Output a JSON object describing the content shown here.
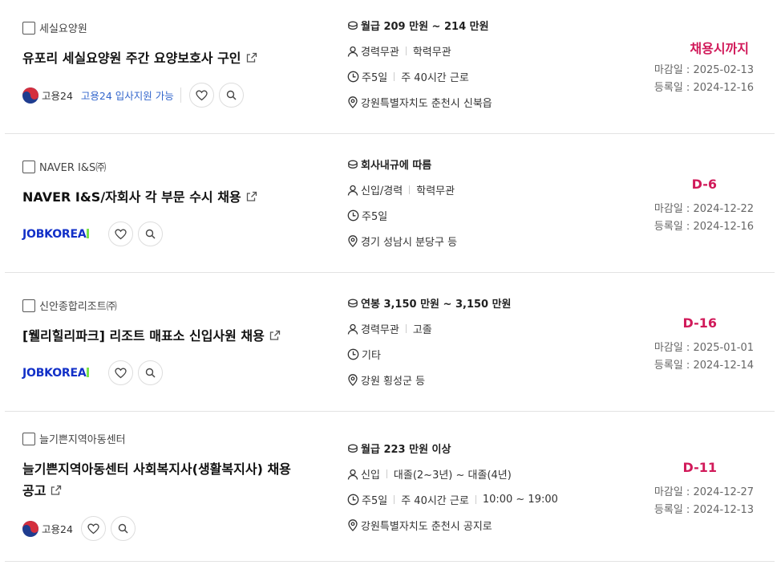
{
  "jobs": [
    {
      "company": "세실요양원",
      "title": "유포리 세실요양원 주간 요양보호사 구인",
      "source": "고용24",
      "support": "고용24 입사지원 가능",
      "salary": "월급 209 만원 ~ 214 만원",
      "experience": "경력무관",
      "education": "학력무관",
      "schedule": [
        "주5일",
        "주 40시간 근로"
      ],
      "location": "강원특별자치도 춘천시 신북읍",
      "dday": "채용시까지",
      "deadline": "마감일 : 2025-02-13",
      "registered": "등록일 : 2024-12-16"
    },
    {
      "company": "NAVER I&S㈜",
      "title": "NAVER I&S/자회사 각 부문 수시 채용",
      "source": "JOBKOREA",
      "salary": "회사내규에 따름",
      "experience": "신입/경력",
      "education": "학력무관",
      "schedule": [
        "주5일"
      ],
      "location": "경기 성남시 분당구 등",
      "dday": "D-6",
      "deadline": "마감일 : 2024-12-22",
      "registered": "등록일 : 2024-12-16"
    },
    {
      "company": "신안종합리조트㈜",
      "title": "[웰리힐리파크] 리조트 매표소 신입사원 채용",
      "source": "JOBKOREA",
      "salary": "연봉 3,150 만원 ~ 3,150 만원",
      "experience": "경력무관",
      "education": "고졸",
      "schedule": [
        "기타"
      ],
      "location": "강원 횡성군 등",
      "dday": "D-16",
      "deadline": "마감일 : 2025-01-01",
      "registered": "등록일 : 2024-12-14"
    },
    {
      "company": "늘기쁜지역아동센터",
      "title_line1": "늘기쁜지역아동센터 사회복지사(생활복지사) 채용",
      "title_line2": "공고",
      "source": "고용24",
      "salary": "월급 223 만원 이상",
      "experience": "신입",
      "education": "대졸(2~3년) ~ 대졸(4년)",
      "schedule": [
        "주5일",
        "주 40시간 근로",
        "10:00 ~ 19:00"
      ],
      "location": "강원특별자치도 춘천시 공지로",
      "dday": "D-11",
      "deadline": "마감일 : 2024-12-27",
      "registered": "등록일 : 2024-12-13"
    }
  ],
  "icons": {
    "salary": "coin-stack-icon",
    "experience": "person-icon",
    "schedule": "clock-icon",
    "location": "location-pin-icon",
    "external": "external-link-icon",
    "favorite": "heart-icon",
    "search": "search-icon"
  },
  "colors": {
    "dday": "#d11a5a",
    "support_link": "#3366cc",
    "jobkorea": "#1230c8"
  }
}
